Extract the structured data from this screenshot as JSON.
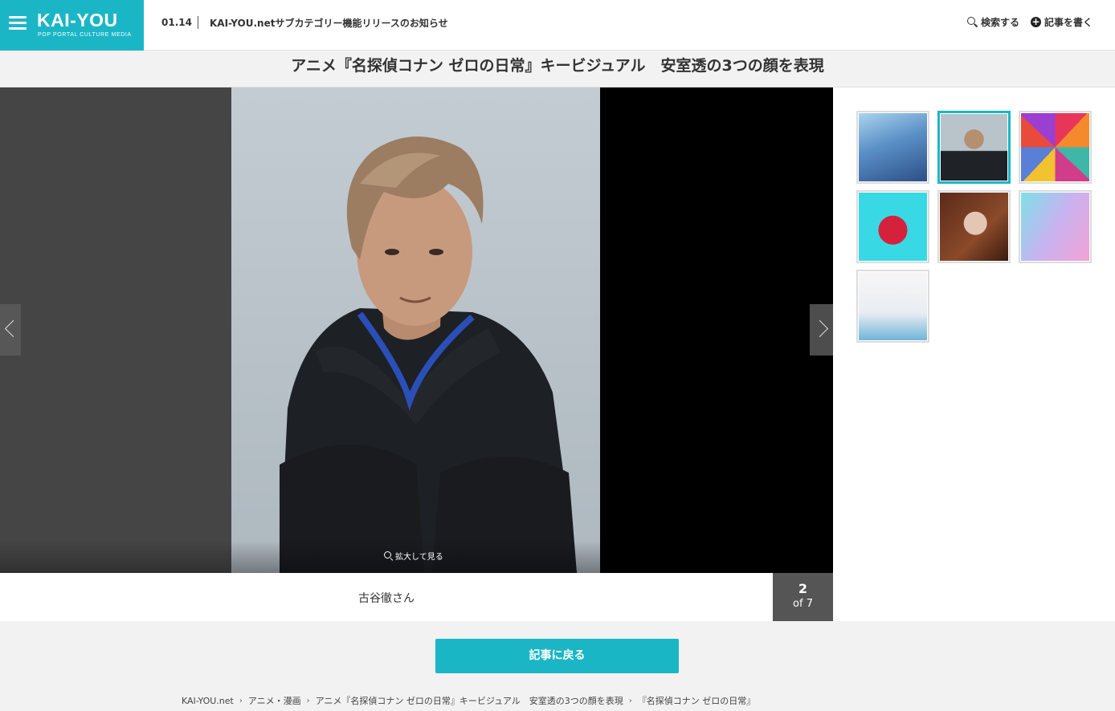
{
  "header": {
    "logo": "KAI-YOU",
    "logo_sub": "POP PORTAL CULTURE MEDIA",
    "news_date": "01.14",
    "news_text": "KAI-YOU.netサブカテゴリー機能リリースのお知らせ",
    "search_label": "検索する",
    "write_label": "記事を書く",
    "accent_color": "#1bb6c6"
  },
  "title": "アニメ『名探偵コナン ゼロの日常』キービジュアル　安室透の3つの顔を表現",
  "viewer": {
    "zoom_label": "拡大して見る",
    "caption": "古谷徹さん",
    "current": "2",
    "total": "of 7"
  },
  "thumbnails": [
    {
      "name": "thumb-anime-keyvisual",
      "active": false
    },
    {
      "name": "thumb-furuya-portrait",
      "active": true
    },
    {
      "name": "thumb-tint-palette",
      "active": false
    },
    {
      "name": "thumb-red-flowers",
      "active": false
    },
    {
      "name": "thumb-blonde-portrait",
      "active": false
    },
    {
      "name": "thumb-woman-pastel",
      "active": false
    },
    {
      "name": "thumb-zero-manga-cover",
      "active": false
    }
  ],
  "back_button": "記事に戻る",
  "breadcrumb": [
    "KAI-YOU.net",
    "アニメ・漫画",
    "アニメ『名探偵コナン ゼロの日常』キービジュアル　安室透の3つの顔を表現",
    "『名探偵コナン ゼロの日常』"
  ]
}
